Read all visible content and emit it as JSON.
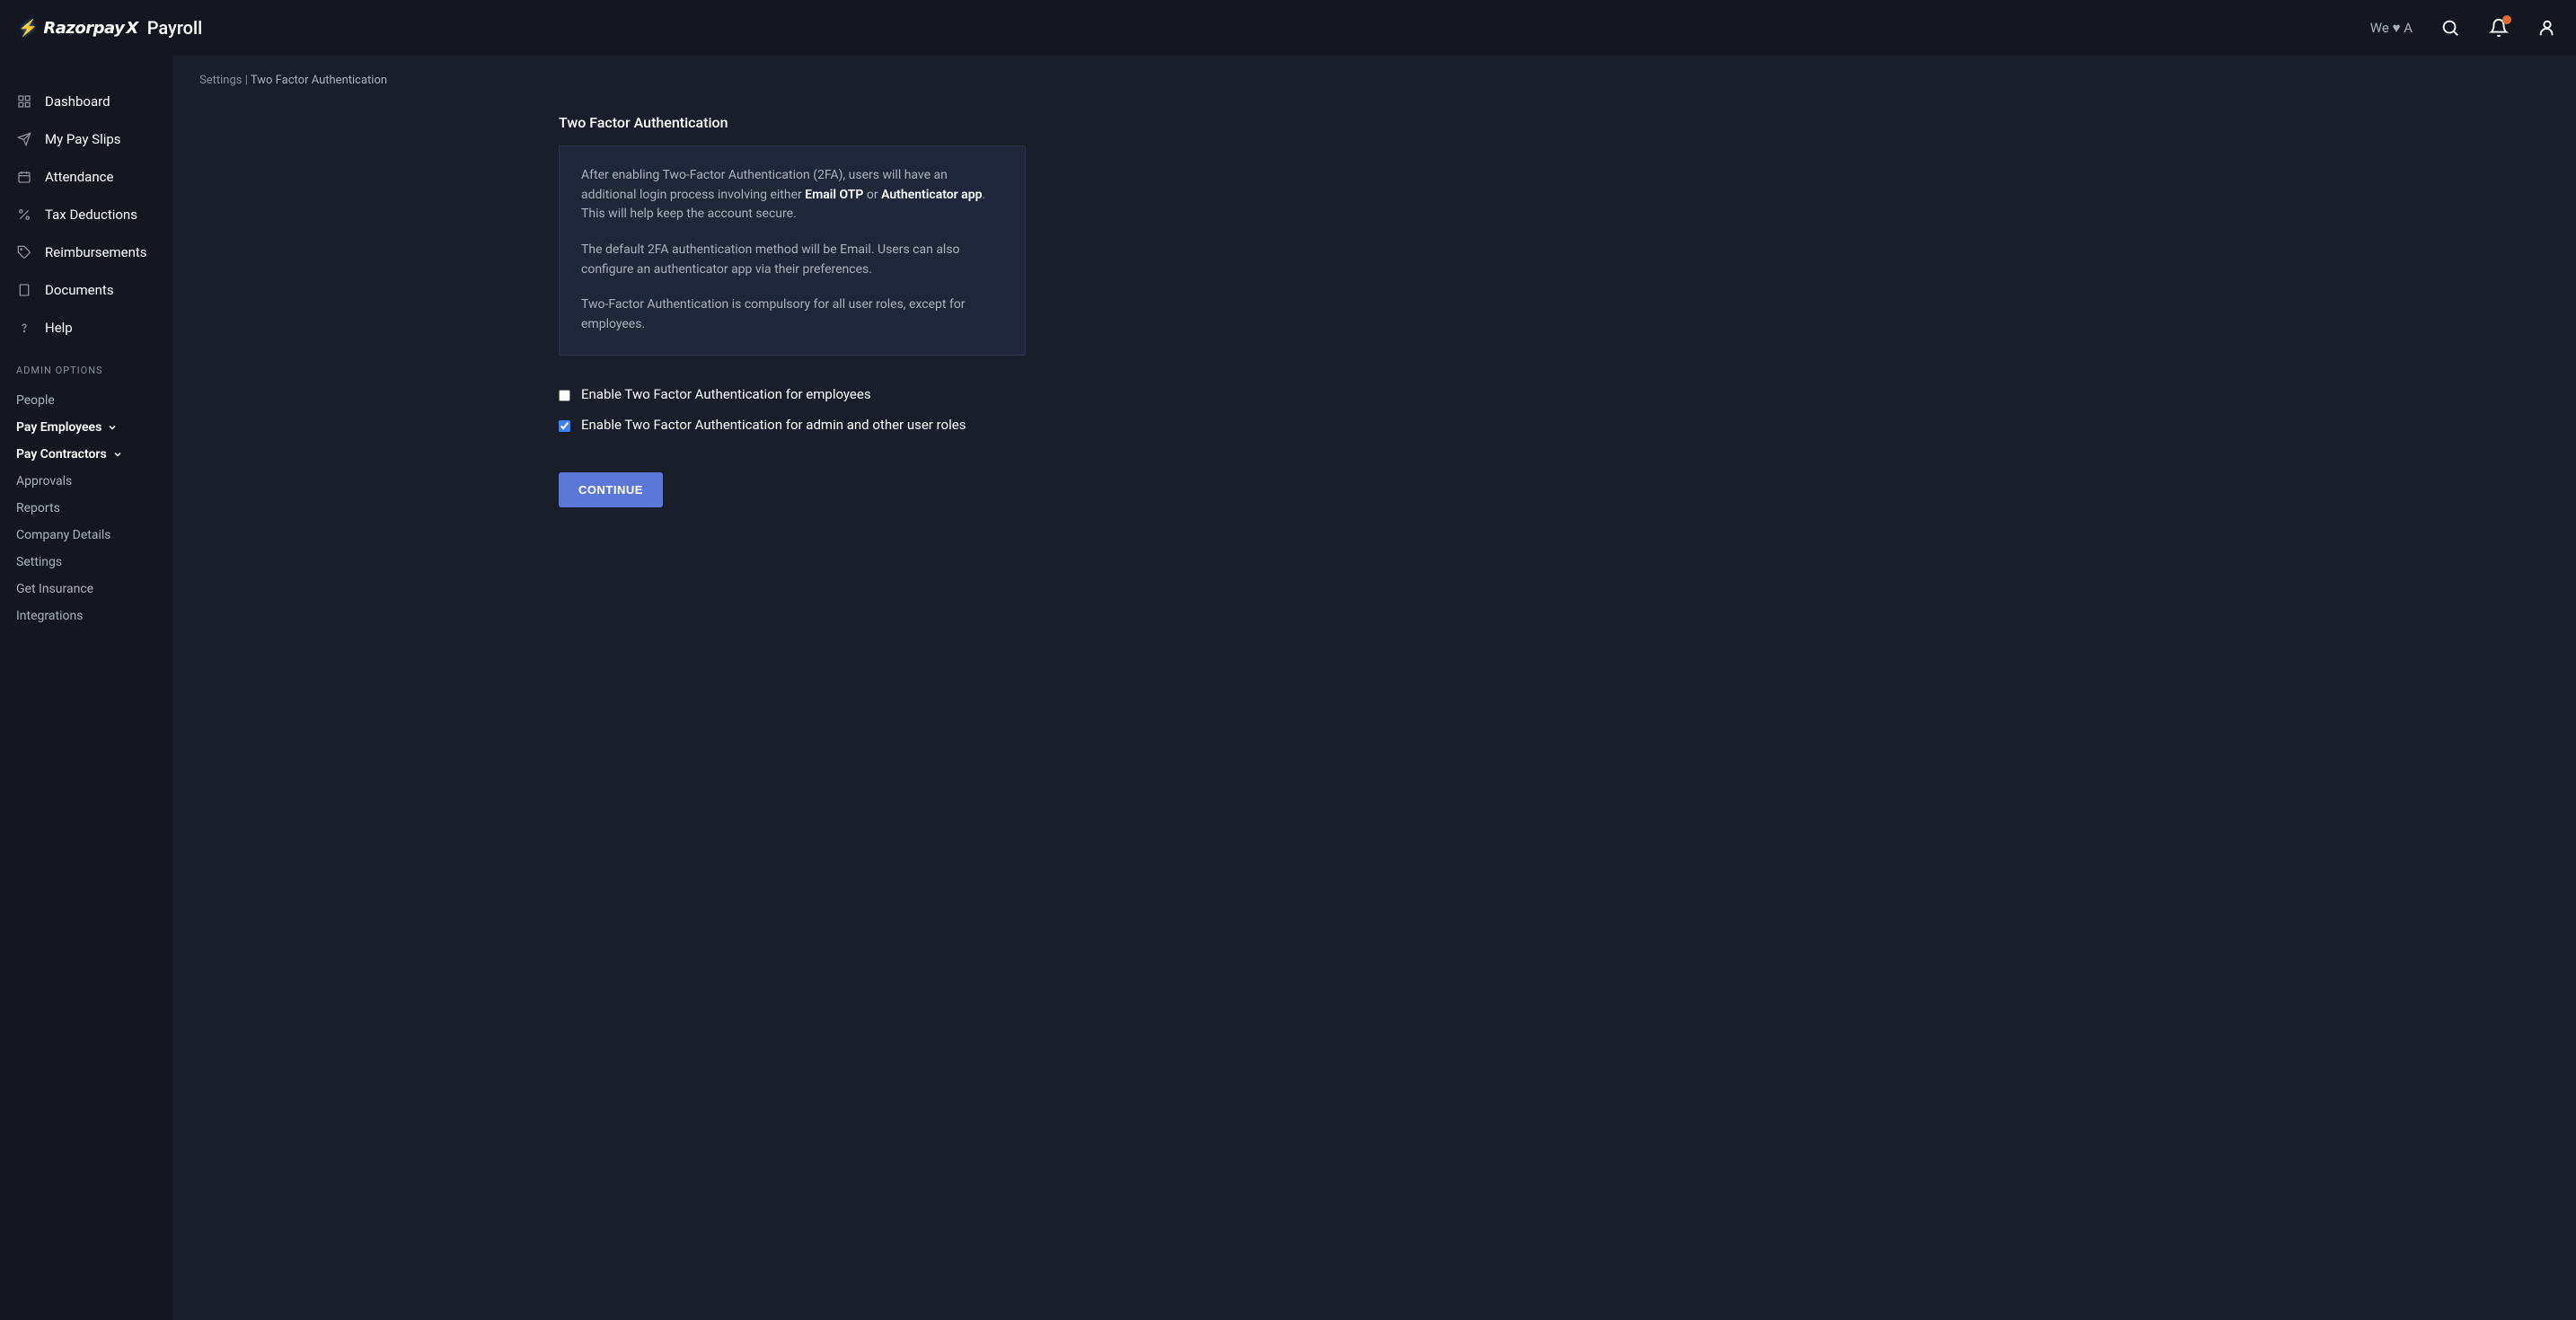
{
  "header": {
    "logo_brand_prefix": "Razorpay",
    "logo_brand_x": "X",
    "logo_product": "Payroll",
    "tagline_prefix": "We",
    "tagline_heart": "♥",
    "tagline_suffix": "A"
  },
  "sidebar": {
    "items": [
      {
        "label": "Dashboard",
        "icon": "grid-icon"
      },
      {
        "label": "My Pay Slips",
        "icon": "send-icon"
      },
      {
        "label": "Attendance",
        "icon": "calendar-icon"
      },
      {
        "label": "Tax Deductions",
        "icon": "percent-icon"
      },
      {
        "label": "Reimbursements",
        "icon": "tag-icon"
      },
      {
        "label": "Documents",
        "icon": "document-icon"
      },
      {
        "label": "Help",
        "icon": "help-icon"
      }
    ],
    "admin_header": "ADMIN OPTIONS",
    "admin_links": [
      {
        "label": "People",
        "expandable": false
      },
      {
        "label": "Pay Employees",
        "expandable": true
      },
      {
        "label": "Pay Contractors",
        "expandable": true
      },
      {
        "label": "Approvals",
        "expandable": false
      },
      {
        "label": "Reports",
        "expandable": false
      },
      {
        "label": "Company Details",
        "expandable": false
      },
      {
        "label": "Settings",
        "expandable": false
      },
      {
        "label": "Get Insurance",
        "expandable": false
      },
      {
        "label": "Integrations",
        "expandable": false
      }
    ]
  },
  "breadcrumb": {
    "root": "Settings",
    "separator": "|",
    "current": "Two Factor Authentication"
  },
  "page": {
    "title": "Two Factor Authentication",
    "info": {
      "p1_pre": "After enabling Two-Factor Authentication (2FA), users will have an additional login process involving either ",
      "p1_strong1": "Email OTP",
      "p1_mid": " or ",
      "p1_strong2": "Authenticator app",
      "p1_post": ". This will help keep the account secure.",
      "p2": "The default 2FA authentication method will be Email. Users can also configure an authenticator app via their preferences.",
      "p3": "Two-Factor Authentication is compulsory for all user roles, except for employees."
    },
    "options": [
      {
        "label": "Enable Two Factor Authentication for employees",
        "checked": false
      },
      {
        "label": "Enable Two Factor Authentication for admin and other user roles",
        "checked": true
      }
    ],
    "continue_label": "CONTINUE"
  }
}
